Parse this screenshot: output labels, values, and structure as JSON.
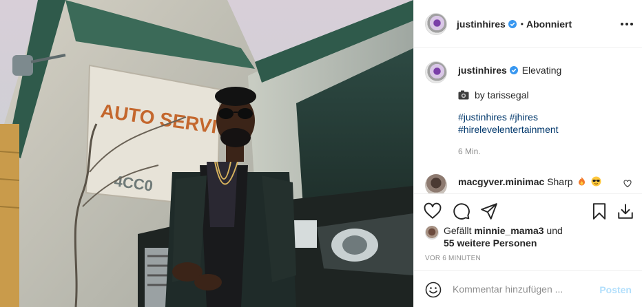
{
  "header": {
    "username": "justinhires",
    "separator": "•",
    "follow_state": "Abonniert"
  },
  "photo": {
    "sign_text": "AUTO SERVICE",
    "sign_number": "4CC0"
  },
  "caption": {
    "username": "justinhires",
    "text": "Elevating",
    "credit": "by tarissegal",
    "hashtags": [
      "#justinhires",
      "#jhires",
      "#hirelevelentertainment"
    ],
    "time": "6 Min."
  },
  "comment": {
    "username": "macgyver.minimac",
    "text": "Sharp"
  },
  "likes": {
    "prefix": "Gefällt",
    "user": "minnie_mama3",
    "middle": "und",
    "others": "55 weitere Personen"
  },
  "post_time": "VOR 6 MINUTEN",
  "add_comment": {
    "placeholder": "Kommentar hinzufügen ...",
    "post_label": "Posten"
  },
  "colors": {
    "verified": "#3897f0",
    "link": "#00376b",
    "post_disabled": "#b2dffc",
    "muted": "#8e8e8e"
  },
  "icons": [
    "verified-badge-icon",
    "more-options-icon",
    "camera-emoji-icon",
    "fire-emoji-icon",
    "sunglasses-emoji-icon",
    "heart-icon",
    "comment-icon",
    "share-icon",
    "bookmark-icon",
    "save-to-device-icon",
    "emoji-icon"
  ]
}
